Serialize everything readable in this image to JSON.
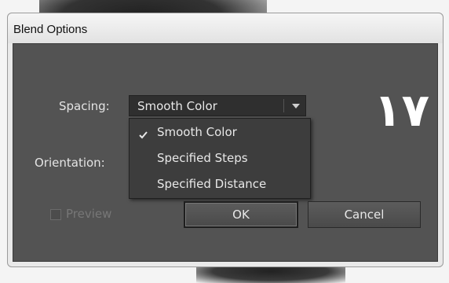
{
  "window": {
    "title": "Blend Options"
  },
  "spacing": {
    "label": "Spacing:",
    "selected": "Smooth Color",
    "options": [
      "Smooth Color",
      "Specified Steps",
      "Specified Distance"
    ]
  },
  "orientation": {
    "label": "Orientation:"
  },
  "preview": {
    "label": "Preview",
    "checked": false,
    "enabled": false
  },
  "buttons": {
    "ok": "OK",
    "cancel": "Cancel"
  },
  "overlay_number": "١٧"
}
